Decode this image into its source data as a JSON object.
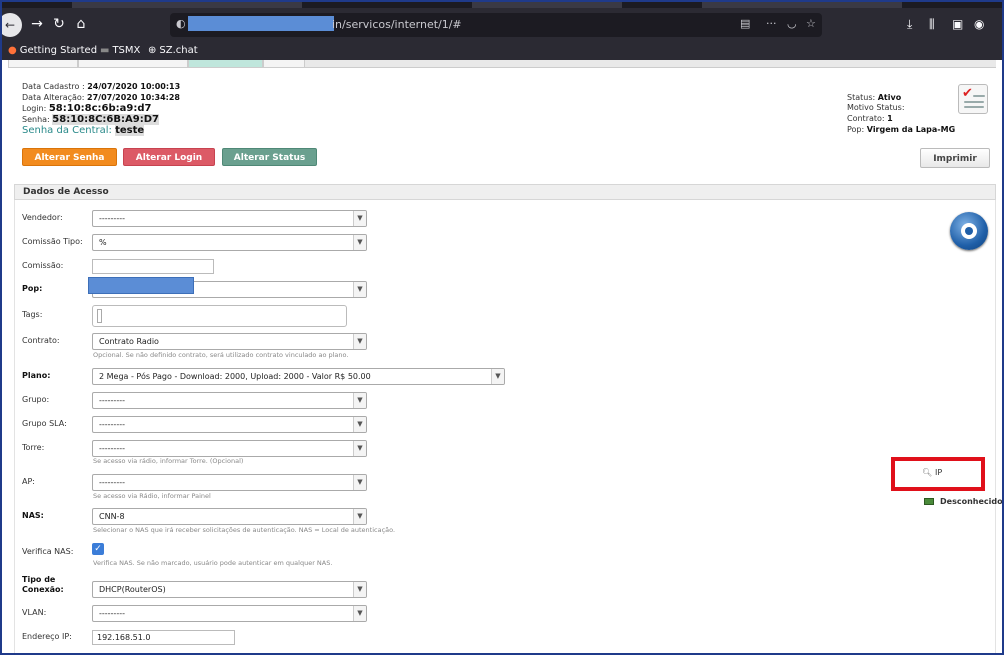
{
  "browser": {
    "url_text": "in/servicos/internet/1/#",
    "bookmarks": [
      "Getting Started",
      "TSMX",
      "SZ.chat"
    ]
  },
  "info": {
    "data_cadastro_label": "Data Cadastro :",
    "data_cadastro_value": "24/07/2020 10:00:13",
    "data_alteracao_label": "Data Alteração:",
    "data_alteracao_value": "27/07/2020 10:34:28",
    "login_label": "Login:",
    "login_value": "58:10:8c:6b:a9:d7",
    "senha_label": "Senha:",
    "senha_value": "58:10:8C:6B:A9:D7",
    "central_label": "Senha da Central:",
    "central_value": "teste"
  },
  "status": {
    "status_label": "Status:",
    "status_value": "Ativo",
    "motivo_label": "Motivo Status:",
    "contrato_label": "Contrato:",
    "contrato_value": "1",
    "pop_label": "Pop:",
    "pop_value": "Virgem da Lapa-MG"
  },
  "buttons": {
    "alterar_senha": "Alterar Senha",
    "alterar_login": "Alterar Login",
    "alterar_status": "Alterar Status",
    "imprimir": "Imprimir"
  },
  "section_title": "Dados de Acesso",
  "form": {
    "vendedor_label": "Vendedor:",
    "vendedor_value": "---------",
    "comissao_tipo_label": "Comissão Tipo:",
    "comissao_tipo_value": "%",
    "comissao_label": "Comissão:",
    "pop_label": "Pop:",
    "tags_label": "Tags:",
    "contrato_label": "Contrato:",
    "contrato_value": "Contrato Radio",
    "contrato_hint": "Opcional. Se não definido contrato, será utilizado contrato vinculado ao plano.",
    "plano_label": "Plano:",
    "plano_value": "2 Mega - Pós Pago - Download: 2000, Upload: 2000 - Valor R$ 50.00",
    "grupo_label": "Grupo:",
    "grupo_value": "---------",
    "grupo_sla_label": "Grupo SLA:",
    "grupo_sla_value": "---------",
    "torre_label": "Torre:",
    "torre_value": "---------",
    "torre_hint": "Se acesso via rádio, informar Torre. (Opcional)",
    "ap_label": "AP:",
    "ap_value": "---------",
    "ap_hint": "Se acesso via Rádio, informar Painel",
    "nas_label": "NAS:",
    "nas_value": "CNN-8",
    "nas_hint": "Selecionar o NAS que irá receber solicitações de autenticação. NAS = Local de autenticação.",
    "verifica_nas_label": "Verifica NAS:",
    "verifica_nas_hint": "Verifica NAS. Se não marcado, usuário pode autenticar em qualquer NAS.",
    "tipo_label_1": "Tipo de",
    "tipo_label_2": "Conexão:",
    "tipo_value": "DHCP(RouterOS)",
    "vlan_label": "VLAN:",
    "vlan_value": "---------",
    "endereco_ip_label": "Endereço IP:",
    "endereco_ip_value": "192.168.51.0"
  },
  "side": {
    "ip_label": "IP",
    "desconhecido": "Desconhecido"
  }
}
